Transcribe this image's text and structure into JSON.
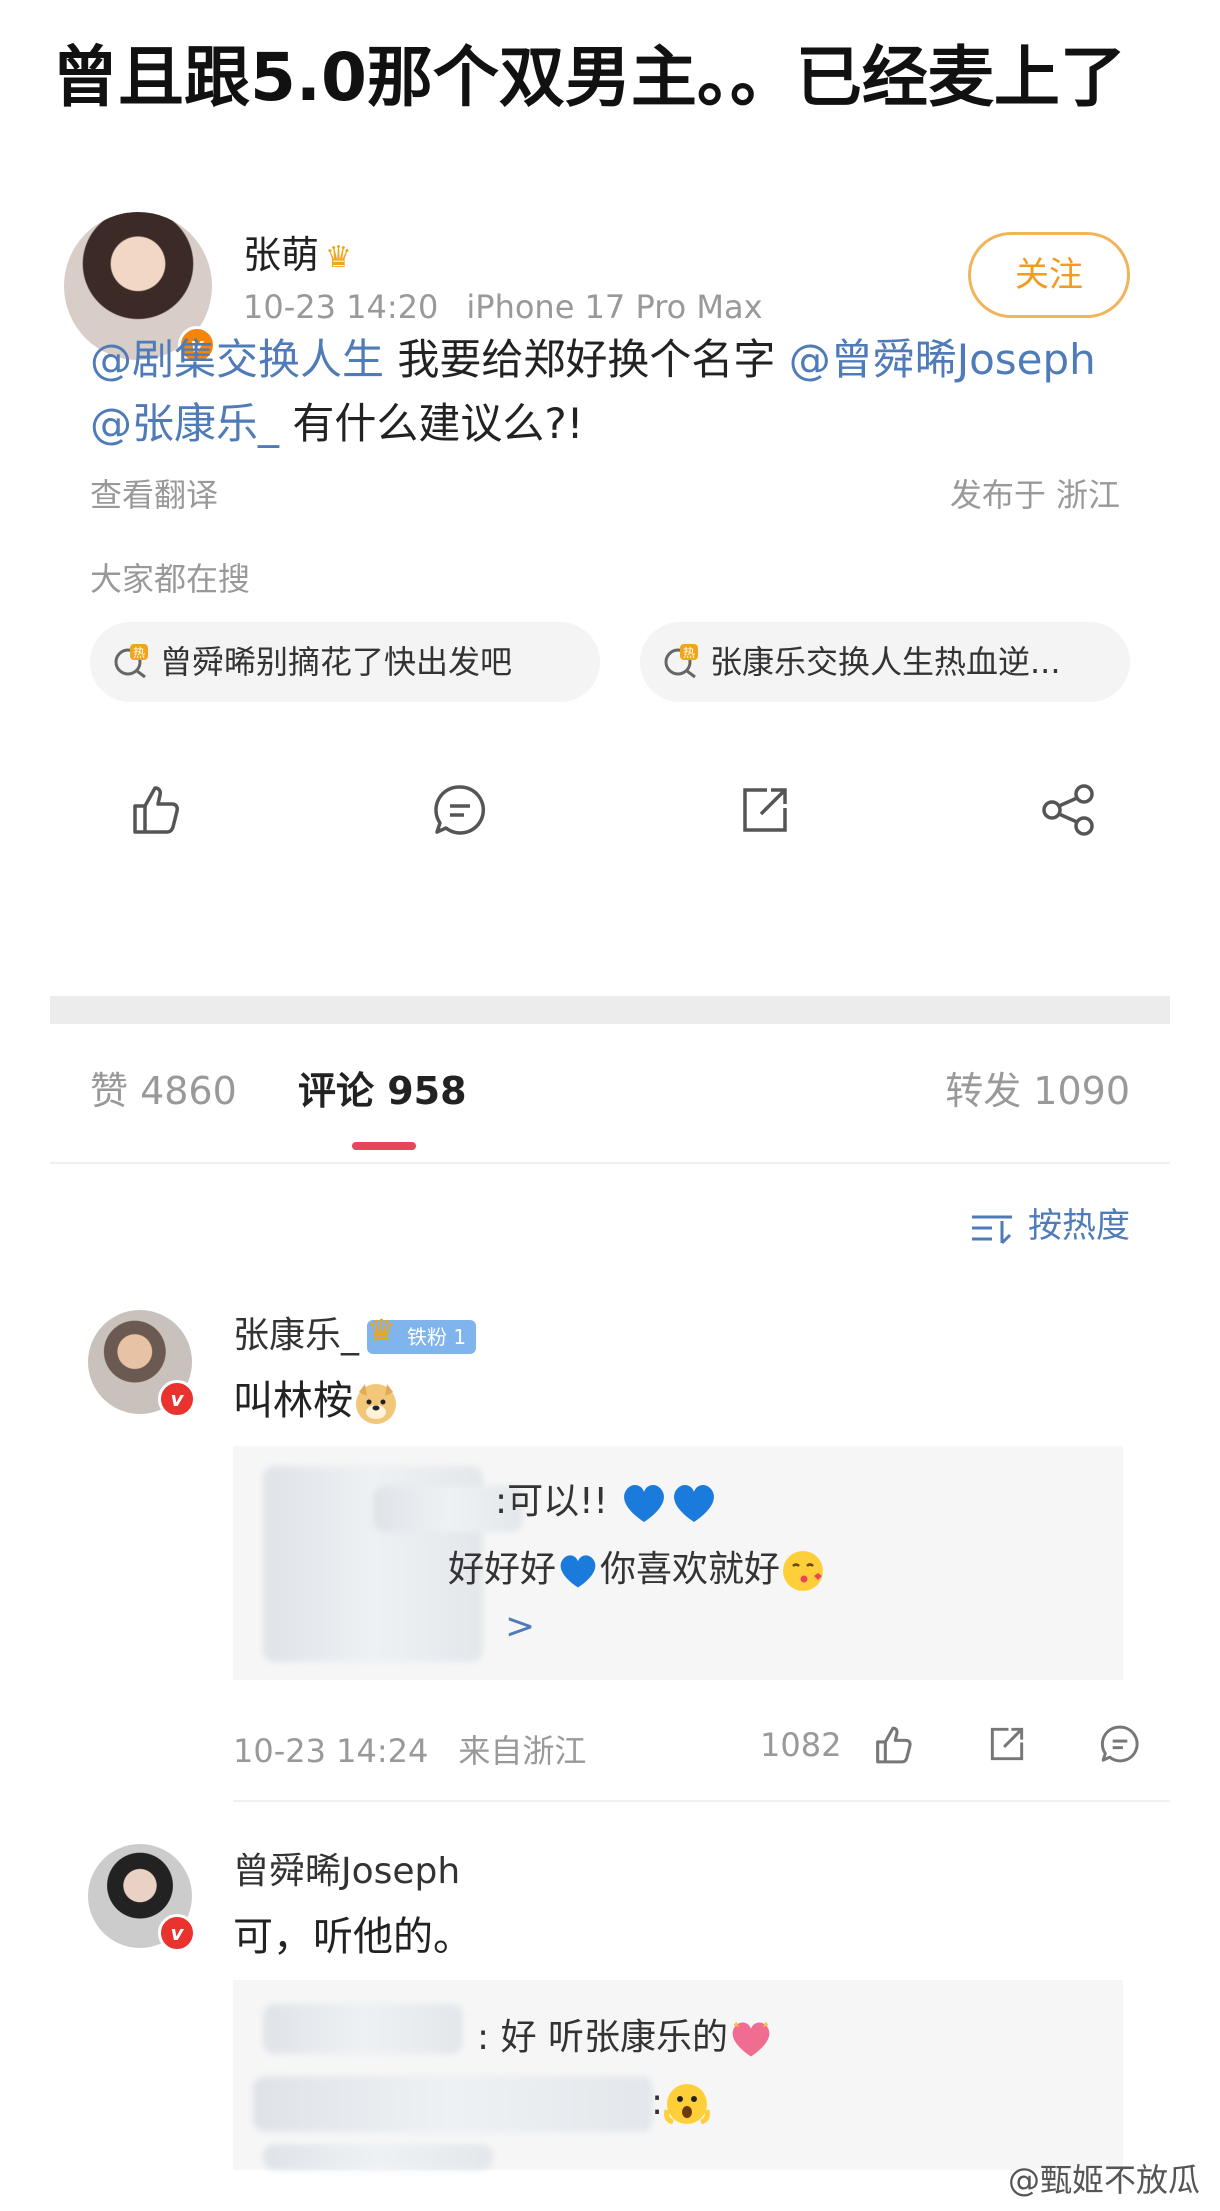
{
  "headline": "曾且跟5.0那个双男主。。已经麦上了",
  "post": {
    "author": "张萌",
    "time": "10-23 14:20",
    "device": "iPhone 17 Pro Max",
    "follow_label": "关注",
    "text_parts": {
      "m1": "@剧集交换人生",
      "t1": " 我要给郑好换个名字 ",
      "m2": "@曾舜晞Joseph",
      "t2": " ",
      "m3": "@张康乐_",
      "t3": " 有什么建议么?!"
    },
    "translate": "查看翻译",
    "location": "发布于 浙江"
  },
  "trending": {
    "label": "大家都在搜",
    "items": [
      {
        "text": "曾舜晞别摘花了快出发吧",
        "badge": "热"
      },
      {
        "text": "张康乐交换人生热血逆...",
        "badge": "热"
      }
    ]
  },
  "actions": {
    "icons": [
      "thumbs-up-icon",
      "comment-icon",
      "share-icon",
      "more-share-icon"
    ]
  },
  "stats": {
    "likes": "赞 4860",
    "comments": "评论 958",
    "reposts": "转发 1090"
  },
  "sort_label": "按热度",
  "comments": [
    {
      "name": "张康乐_",
      "fan_badge": "铁粉 1",
      "text": "叫林桉",
      "reply_lines": [
        ":可以!!",
        "好好好",
        "你喜欢就好",
        ">"
      ],
      "time": "10-23 14:24",
      "location": "来自浙江",
      "likes": "1082"
    },
    {
      "name": "曾舜晞Joseph",
      "text": "可，听他的。",
      "reply_lines": [
        ": 好 听张康乐的",
        ":"
      ]
    }
  ],
  "watermark": "@甄姬不放瓜",
  "colors": {
    "accent_blue": "#4f7bb8",
    "follow_orange": "#f29b20",
    "tab_underline": "#e8445a",
    "fan_badge": "#7fb4ec"
  }
}
